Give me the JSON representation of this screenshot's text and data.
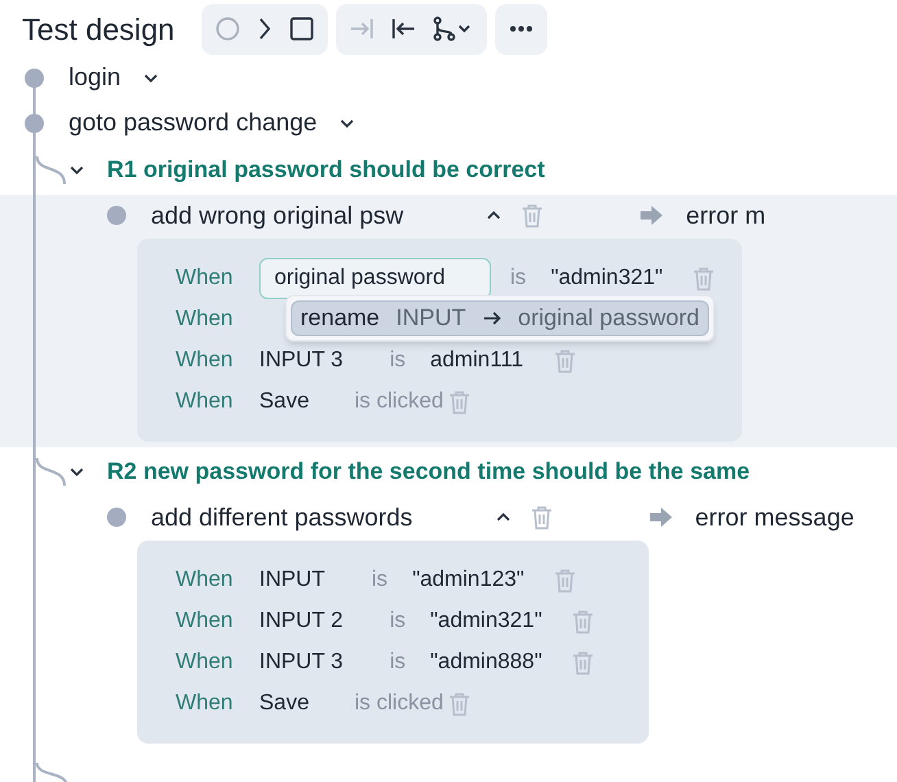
{
  "title": "Test design",
  "toolbar_groups": [
    {
      "buttons": [
        {
          "kind": "circle",
          "disabled": false
        },
        {
          "kind": "chevron",
          "disabled": false
        },
        {
          "kind": "square",
          "disabled": false
        }
      ]
    },
    {
      "buttons": [
        {
          "kind": "to-bar",
          "disabled": true
        },
        {
          "kind": "from-bar",
          "disabled": false
        },
        {
          "kind": "branch",
          "disabled": false
        }
      ]
    },
    {
      "buttons": [
        {
          "kind": "more",
          "disabled": false
        }
      ]
    }
  ],
  "nodes": [
    {
      "label": "login"
    },
    {
      "label": "goto password change"
    }
  ],
  "rules": [
    {
      "title": "R1 original password should be correct",
      "expanded": true,
      "steps": [
        {
          "name": "add wrong original psw",
          "expanded": true,
          "selected": true,
          "result": "error m",
          "conditions": [
            {
              "kind": "value",
              "when": "When",
              "target": "original password",
              "editing": true,
              "op": "is",
              "value": "\"admin321\"",
              "popup": {
                "verb": "rename",
                "from": "INPUT",
                "to": "original password"
              }
            },
            {
              "kind": "covered",
              "when": "When"
            },
            {
              "kind": "value",
              "when": "When",
              "target": "INPUT 3",
              "editing": false,
              "op": "is",
              "value": "admin111"
            },
            {
              "kind": "click",
              "when": "When",
              "target": "Save",
              "op": "is clicked"
            }
          ]
        }
      ]
    },
    {
      "title": "R2 new password for the second time should be the same",
      "expanded": true,
      "steps": [
        {
          "name": "add different passwords",
          "expanded": true,
          "selected": false,
          "result": "error message",
          "conditions": [
            {
              "kind": "value",
              "when": "When",
              "target": "INPUT",
              "editing": false,
              "op": "is",
              "value": "\"admin123\""
            },
            {
              "kind": "value",
              "when": "When",
              "target": "INPUT 2",
              "editing": false,
              "op": "is",
              "value": "\"admin321\""
            },
            {
              "kind": "value",
              "when": "When",
              "target": "INPUT 3",
              "editing": false,
              "op": "is",
              "value": "\"admin888\""
            },
            {
              "kind": "click",
              "when": "When",
              "target": "Save",
              "op": "is clicked"
            }
          ]
        }
      ]
    }
  ]
}
